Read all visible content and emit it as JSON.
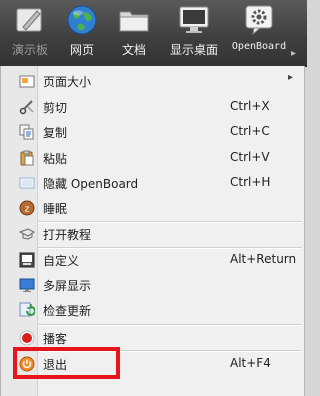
{
  "toolbar": {
    "buttons": [
      {
        "label": "演示板",
        "icon": "board-pen-icon",
        "enabled": false
      },
      {
        "label": "网页",
        "icon": "globe-icon",
        "enabled": true
      },
      {
        "label": "文档",
        "icon": "folder-icon",
        "enabled": true
      },
      {
        "label": "显示桌面",
        "icon": "monitor-icon",
        "enabled": true
      },
      {
        "label": "OpenBoard",
        "icon": "gear-bubble-icon",
        "enabled": true
      }
    ],
    "more_arrow": "▸"
  },
  "menu": {
    "items": [
      {
        "label": "页面大小",
        "shortcut": "",
        "icon": "page-size-icon",
        "submenu": true
      },
      {
        "label": "剪切",
        "shortcut": "Ctrl+X",
        "icon": "cut-icon"
      },
      {
        "label": "复制",
        "shortcut": "Ctrl+C",
        "icon": "copy-icon"
      },
      {
        "label": "粘贴",
        "shortcut": "Ctrl+V",
        "icon": "paste-icon"
      },
      {
        "label": "隐藏 OpenBoard",
        "shortcut": "Ctrl+H",
        "icon": "hide-icon"
      },
      {
        "label": "睡眠",
        "shortcut": "",
        "icon": "sleep-icon"
      },
      {
        "label": "打开教程",
        "shortcut": "",
        "icon": "tutorial-icon"
      },
      {
        "label": "自定义",
        "shortcut": "Alt+Return",
        "icon": "customize-icon"
      },
      {
        "label": "多屏显示",
        "shortcut": "",
        "icon": "multiscreen-icon"
      },
      {
        "label": "检查更新",
        "shortcut": "",
        "icon": "update-icon"
      },
      {
        "label": "播客",
        "shortcut": "",
        "icon": "podcast-record-icon"
      },
      {
        "label": "退出",
        "shortcut": "Alt+F4",
        "icon": "quit-power-icon"
      }
    ],
    "submenu_arrow": "▸"
  },
  "colors": {
    "highlight_box": "#e8141b",
    "menu_bg": "#f0f0f0",
    "toolbar_bg": "#3e3e3e"
  }
}
